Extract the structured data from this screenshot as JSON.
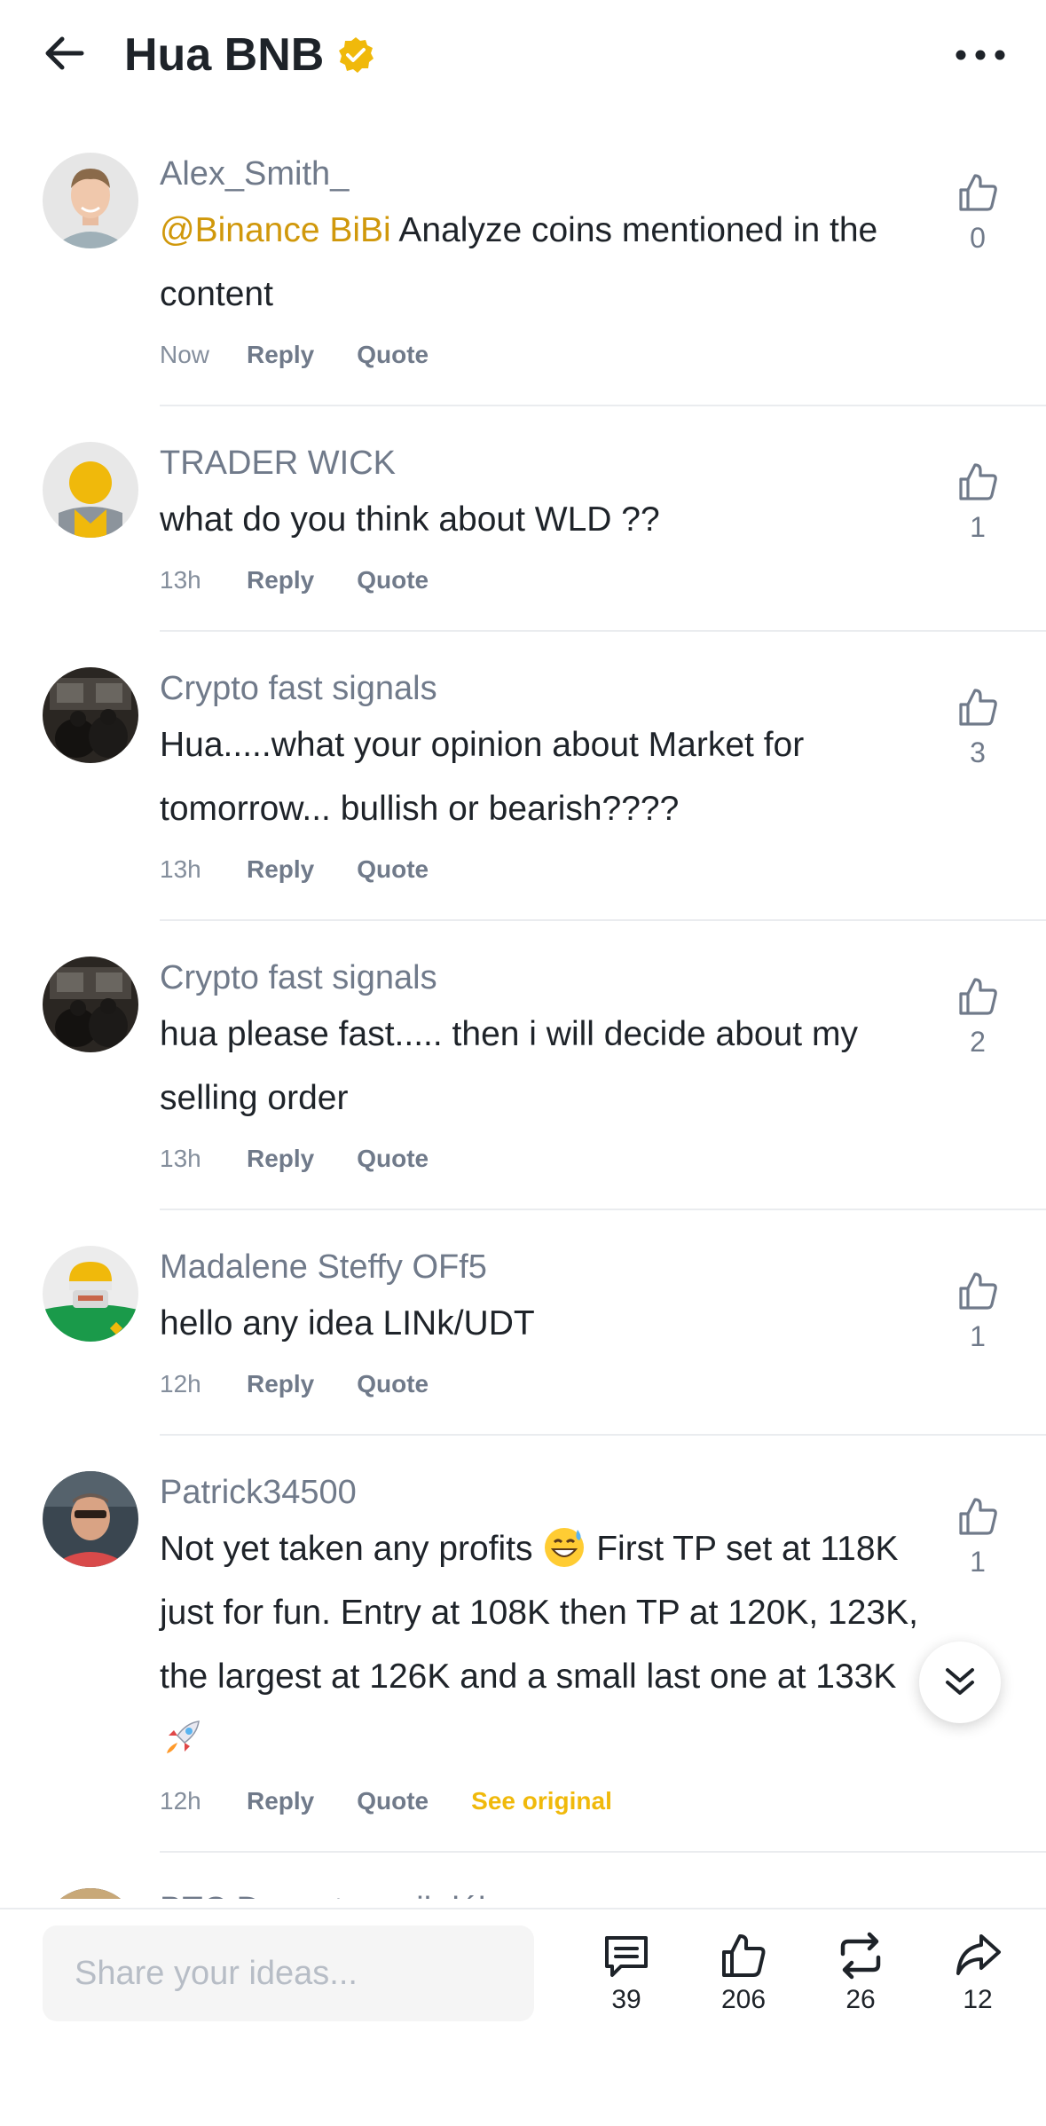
{
  "header": {
    "title": "Hua BNB",
    "back_icon": "arrow-left-icon",
    "verified_icon": "verified-badge-icon",
    "more_icon": "more-horizontal-icon",
    "verified_color": "#f0b90b"
  },
  "comments": [
    {
      "username": "Alex_Smith_",
      "mention": "@Binance BiBi",
      "text": " Analyze coins mentioned in the content",
      "time": "Now",
      "reply": "Reply",
      "quote": "Quote",
      "likes": "0"
    },
    {
      "username": "TRADER WICK",
      "text": "what do you think about WLD ??",
      "time": "13h",
      "reply": "Reply",
      "quote": "Quote",
      "likes": "1"
    },
    {
      "username": "Crypto fast signals",
      "text": "Hua.....what your opinion about Market for tomorrow... bullish or bearish????",
      "time": "13h",
      "reply": "Reply",
      "quote": "Quote",
      "likes": "3"
    },
    {
      "username": "Crypto fast signals",
      "text": "hua please fast..... then i will decide about my selling order",
      "time": "13h",
      "reply": "Reply",
      "quote": "Quote",
      "likes": "2"
    },
    {
      "username": "Madalene Steffy OFf5",
      "text": "hello any idea LINk/UDT",
      "time": "12h",
      "reply": "Reply",
      "quote": "Quote",
      "likes": "1"
    },
    {
      "username": "Patrick34500",
      "text_a": "Not yet taken any profits ",
      "text_b": " First TP set at 118K just for fun. Entry at 108K then TP at 120K, 123K, the largest at 126K and a small last one at 133K ",
      "time": "12h",
      "reply": "Reply",
      "quote": "Quote",
      "see_original": "See original",
      "likes": "1"
    },
    {
      "username": "BTC Duzentos mil dólar"
    }
  ],
  "bottom_bar": {
    "placeholder": "Share your ideas...",
    "comments_count": "39",
    "likes_count": "206",
    "reposts_count": "26",
    "shares_count": "12"
  },
  "colors": {
    "accent": "#f0b90b",
    "mention": "#d0980b",
    "text_primary": "#1e2329",
    "text_secondary": "#707a8a"
  }
}
